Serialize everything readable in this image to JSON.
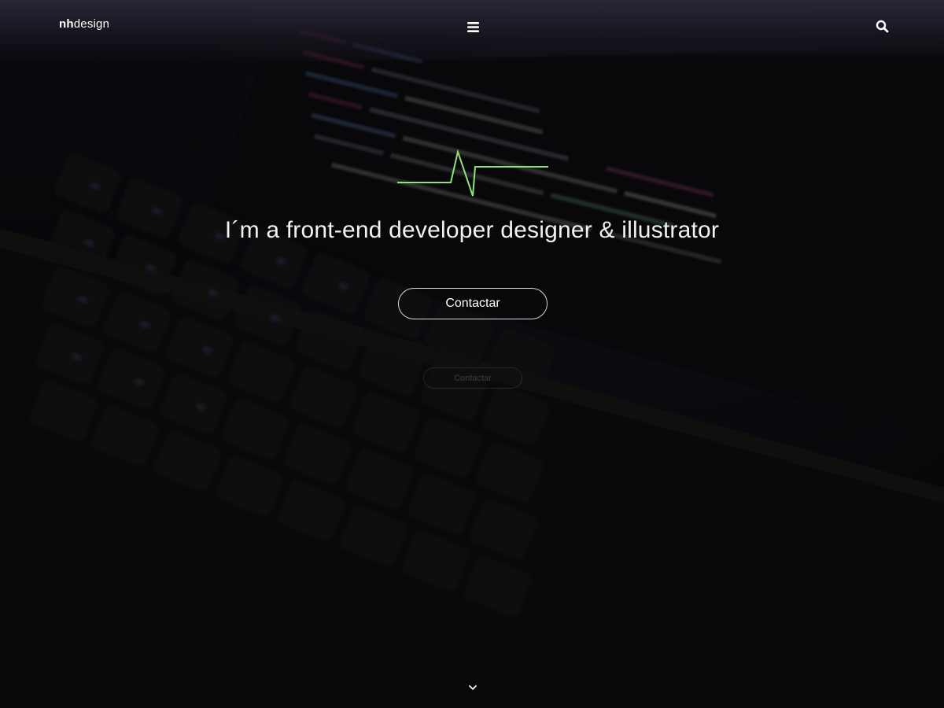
{
  "header": {
    "logo_strong": "nh",
    "logo_rest": "design",
    "menu_icon": "hamburger-menu-icon",
    "search_icon": "search-icon"
  },
  "hero": {
    "headline": "I´m a front-end developer designer & illustrator",
    "cta_label": "Contactar",
    "ghost_cta_label": "Contactar",
    "accent_color": "#8fe27a"
  },
  "footer": {
    "scroll_icon": "chevron-down-icon"
  }
}
